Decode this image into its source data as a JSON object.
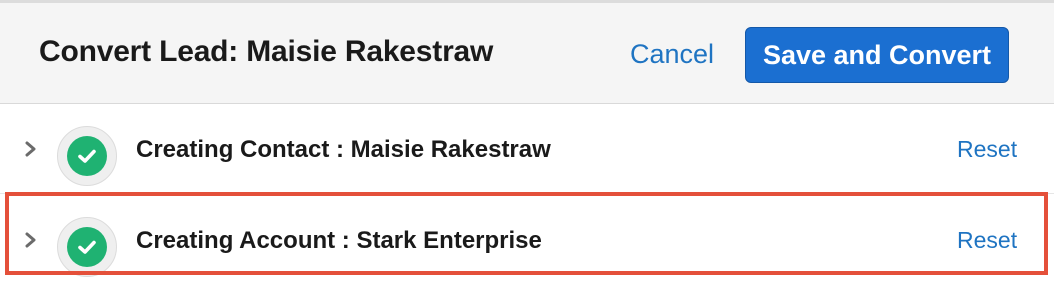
{
  "header": {
    "title": "Convert Lead: Maisie Rakestraw",
    "cancel_label": "Cancel",
    "save_label": "Save and Convert"
  },
  "rows": [
    {
      "label": "Creating Contact : Maisie Rakestraw",
      "status": "complete",
      "reset_label": "Reset",
      "expand_icon": "chevron-right-icon",
      "status_icon": "check-circle-icon"
    },
    {
      "label": "Creating Account : Stark Enterprise",
      "status": "complete",
      "reset_label": "Reset",
      "expand_icon": "chevron-right-icon",
      "status_icon": "check-circle-icon",
      "highlighted": true
    }
  ],
  "colors": {
    "accent": "#1b6fd1",
    "link": "#1f74c2",
    "success": "#1fb272",
    "highlight_border": "#e4503a"
  }
}
